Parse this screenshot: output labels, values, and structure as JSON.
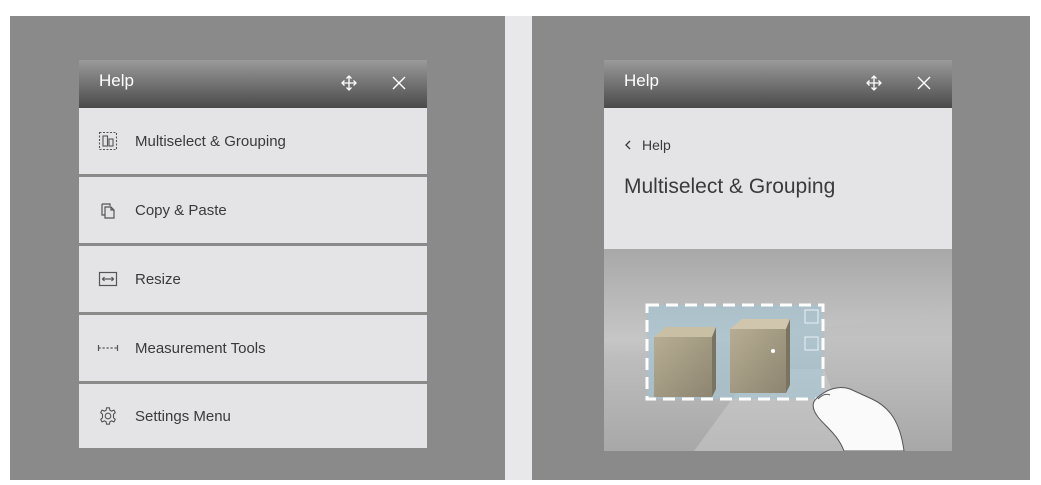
{
  "left_panel": {
    "header": {
      "title": "Help"
    },
    "menu_items": [
      {
        "label": "Multiselect & Grouping",
        "icon": "multiselect-icon"
      },
      {
        "label": "Copy & Paste",
        "icon": "copy-icon"
      },
      {
        "label": "Resize",
        "icon": "resize-icon"
      },
      {
        "label": "Measurement Tools",
        "icon": "measure-icon"
      },
      {
        "label": "Settings Menu",
        "icon": "gear-icon"
      }
    ]
  },
  "right_panel": {
    "header": {
      "title": "Help"
    },
    "back_label": "Help",
    "page_title": "Multiselect & Grouping"
  }
}
